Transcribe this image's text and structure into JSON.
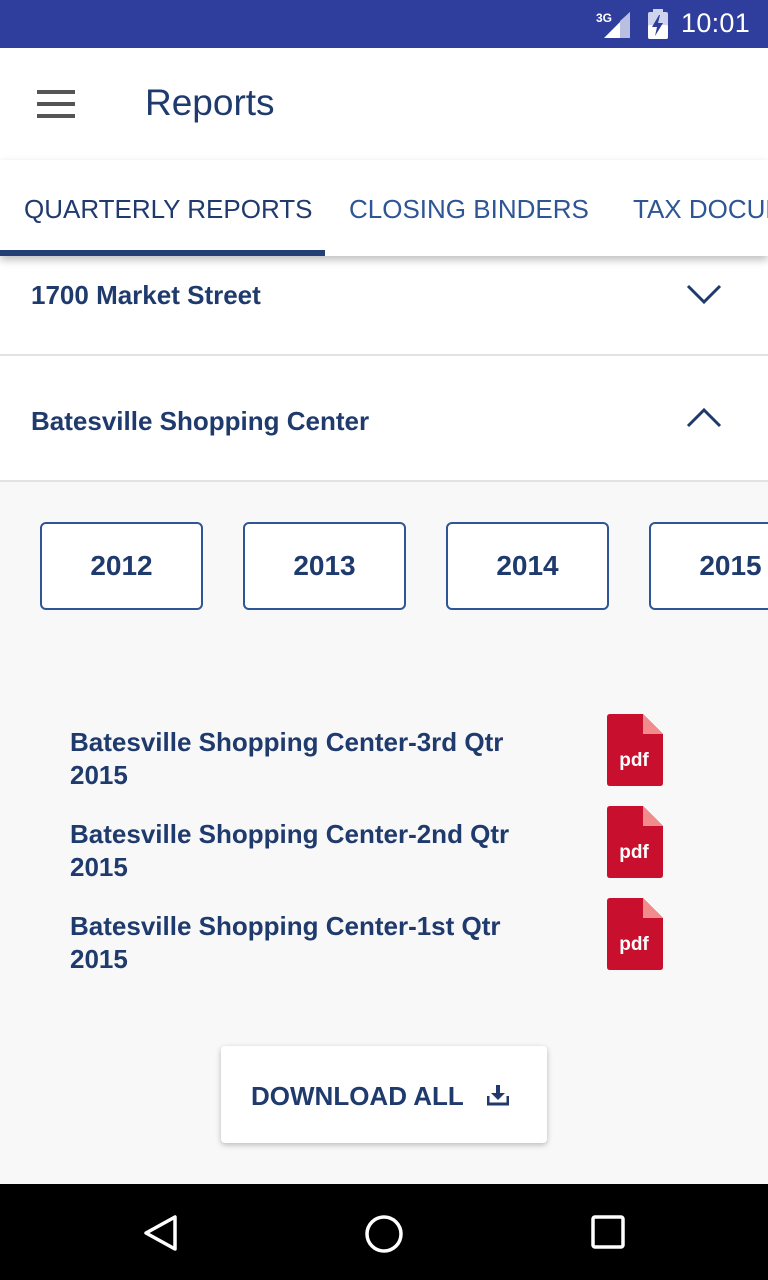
{
  "status_bar": {
    "network": "3G",
    "time": "10:01"
  },
  "app_bar": {
    "title": "Reports",
    "menu_icon": "hamburger-menu-icon"
  },
  "tabs": [
    {
      "label": "QUARTERLY REPORTS",
      "active": true
    },
    {
      "label": "CLOSING BINDERS",
      "active": false
    },
    {
      "label": "TAX DOCUMENTS",
      "active": false
    }
  ],
  "properties": [
    {
      "name": "1700 Market Street",
      "expanded": false
    },
    {
      "name": "Batesville Shopping Center",
      "expanded": true
    }
  ],
  "years": [
    "2012",
    "2013",
    "2014",
    "2015"
  ],
  "reports": [
    {
      "title": "Batesville Shopping Center-3rd Qtr 2015",
      "file_label": "pdf"
    },
    {
      "title": "Batesville Shopping Center-2nd Qtr 2015",
      "file_label": "pdf"
    },
    {
      "title": "Batesville Shopping Center-1st Qtr 2015",
      "file_label": "pdf"
    }
  ],
  "download_all": {
    "label": "DOWNLOAD ALL",
    "icon": "download-icon"
  },
  "colors": {
    "status_bar": "#2f3e9c",
    "primary_text": "#1f3a6d",
    "pdf_red": "#c8102e"
  }
}
